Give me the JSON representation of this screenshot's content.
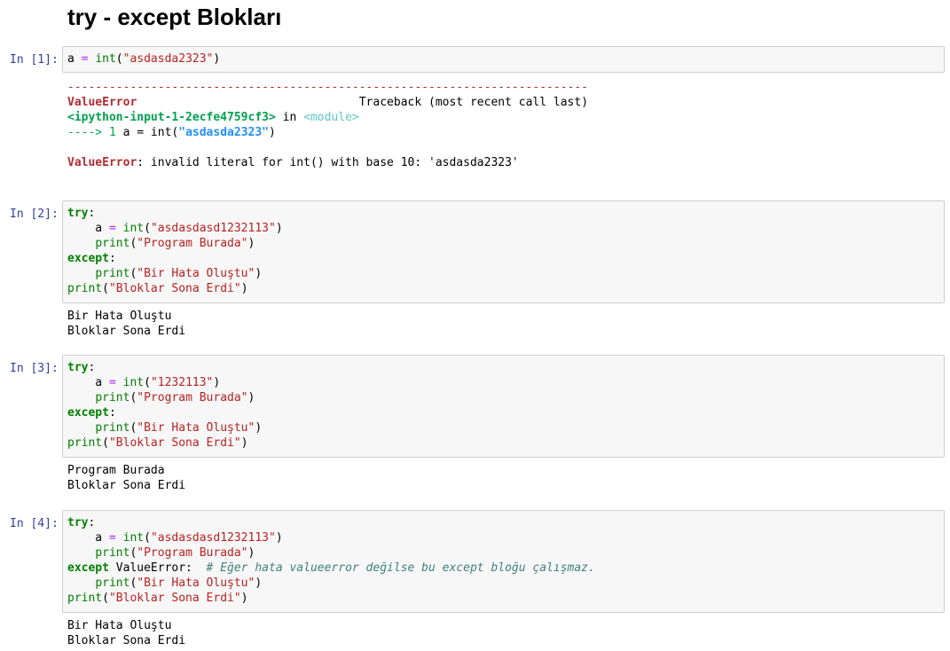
{
  "heading": "try - except Blokları",
  "cells": [
    {
      "prompt": "In [1]:",
      "code": [
        "a = int(\"asdasda2323\")"
      ],
      "traceback": {
        "dashes": "---------------------------------------------------------------------------",
        "error_name": "ValueError",
        "traceback_label": "Traceback (most recent call last)",
        "input_ref": "<ipython-input-1-2ecfe4759cf3>",
        "in_word": "in",
        "module": "<module>",
        "arrow": "---->",
        "line_no": "1",
        "line_code_prefix": "a = int(",
        "line_code_str": "\"asdasda2323\"",
        "line_code_suffix": ")",
        "error_msg": ": invalid literal for int() with base 10: 'asdasda2323'"
      }
    },
    {
      "prompt": "In [2]:",
      "output": [
        "Bir Hata Oluştu",
        "Bloklar Sona Erdi"
      ]
    },
    {
      "prompt": "In [3]:",
      "output": [
        "Program Burada",
        "Bloklar Sona Erdi"
      ]
    },
    {
      "prompt": "In [4]:",
      "comment": "# Eğer hata valueerror değilse bu except bloğu çalışmaz.",
      "output": [
        "Bir Hata Oluştu",
        "Bloklar Sona Erdi"
      ]
    }
  ],
  "strings": {
    "s_asdasda2323": "\"asdasda2323\"",
    "s_asdasdasd": "\"asdasdasd1232113\"",
    "s_1232113": "\"1232113\"",
    "s_program": "\"Program Burada\"",
    "s_hata": "\"Bir Hata Oluştu\"",
    "s_bloklar": "\"Bloklar Sona Erdi\""
  }
}
